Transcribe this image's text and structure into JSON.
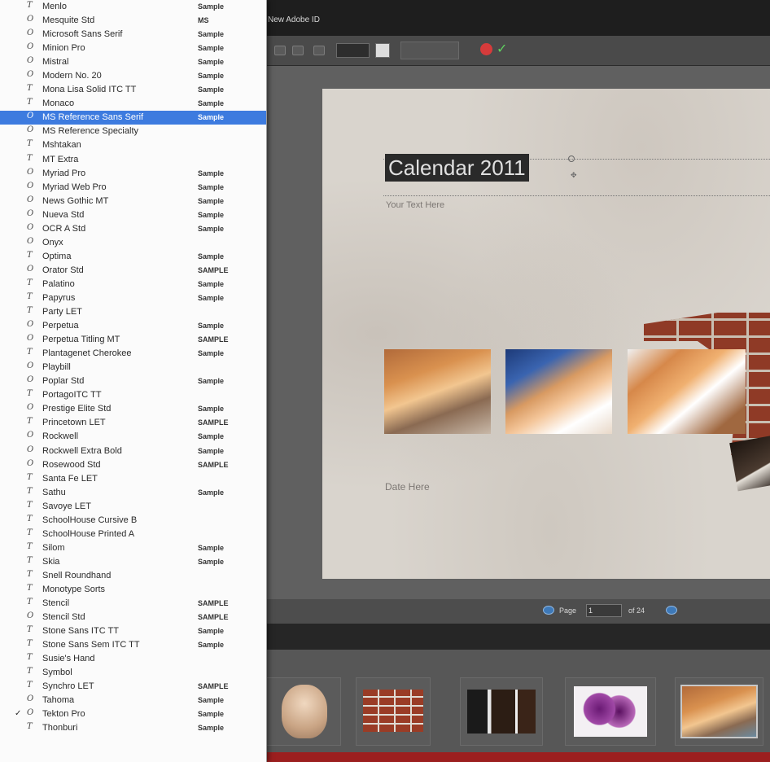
{
  "window": {
    "title": "New Adobe ID"
  },
  "font_menu": {
    "fonts": [
      {
        "name": "Menlo",
        "sample": "Sample",
        "type_icon": "truetype-icon",
        "checked": false,
        "selected": false
      },
      {
        "name": "Mesquite Std",
        "sample": "MS",
        "type_icon": "opentype-icon",
        "checked": false,
        "selected": false
      },
      {
        "name": "Microsoft Sans Serif",
        "sample": "Sample",
        "type_icon": "opentype-icon",
        "checked": false,
        "selected": false
      },
      {
        "name": "Minion Pro",
        "sample": "Sample",
        "type_icon": "opentype-icon",
        "checked": false,
        "selected": false
      },
      {
        "name": "Mistral",
        "sample": "Sample",
        "type_icon": "opentype-icon",
        "checked": false,
        "selected": false
      },
      {
        "name": "Modern No. 20",
        "sample": "Sample",
        "type_icon": "opentype-icon",
        "checked": false,
        "selected": false
      },
      {
        "name": "Mona Lisa Solid ITC TT",
        "sample": "Sample",
        "type_icon": "truetype-icon",
        "checked": false,
        "selected": false
      },
      {
        "name": "Monaco",
        "sample": "Sample",
        "type_icon": "truetype-icon",
        "checked": false,
        "selected": false
      },
      {
        "name": "MS Reference Sans Serif",
        "sample": "Sample",
        "type_icon": "opentype-icon",
        "checked": false,
        "selected": true
      },
      {
        "name": "MS Reference Specialty",
        "sample": "",
        "type_icon": "opentype-icon",
        "checked": false,
        "selected": false
      },
      {
        "name": "Mshtakan",
        "sample": "",
        "type_icon": "truetype-icon",
        "checked": false,
        "selected": false
      },
      {
        "name": "MT Extra",
        "sample": "",
        "type_icon": "truetype-icon",
        "checked": false,
        "selected": false
      },
      {
        "name": "Myriad Pro",
        "sample": "Sample",
        "type_icon": "opentype-icon",
        "checked": false,
        "selected": false
      },
      {
        "name": "Myriad Web Pro",
        "sample": "Sample",
        "type_icon": "opentype-icon",
        "checked": false,
        "selected": false
      },
      {
        "name": "News Gothic MT",
        "sample": "Sample",
        "type_icon": "opentype-icon",
        "checked": false,
        "selected": false
      },
      {
        "name": "Nueva Std",
        "sample": "Sample",
        "type_icon": "opentype-icon",
        "checked": false,
        "selected": false
      },
      {
        "name": "OCR A Std",
        "sample": "Sample",
        "type_icon": "opentype-icon",
        "checked": false,
        "selected": false
      },
      {
        "name": "Onyx",
        "sample": "",
        "type_icon": "opentype-icon",
        "checked": false,
        "selected": false
      },
      {
        "name": "Optima",
        "sample": "Sample",
        "type_icon": "truetype-icon",
        "checked": false,
        "selected": false
      },
      {
        "name": "Orator Std",
        "sample": "SAMPLE",
        "type_icon": "opentype-icon",
        "checked": false,
        "selected": false
      },
      {
        "name": "Palatino",
        "sample": "Sample",
        "type_icon": "truetype-icon",
        "checked": false,
        "selected": false
      },
      {
        "name": "Papyrus",
        "sample": "Sample",
        "type_icon": "truetype-icon",
        "checked": false,
        "selected": false
      },
      {
        "name": "Party LET",
        "sample": "",
        "type_icon": "truetype-icon",
        "checked": false,
        "selected": false
      },
      {
        "name": "Perpetua",
        "sample": "Sample",
        "type_icon": "opentype-icon",
        "checked": false,
        "selected": false
      },
      {
        "name": "Perpetua Titling MT",
        "sample": "SAMPLE",
        "type_icon": "opentype-icon",
        "checked": false,
        "selected": false
      },
      {
        "name": "Plantagenet Cherokee",
        "sample": "Sample",
        "type_icon": "truetype-icon",
        "checked": false,
        "selected": false
      },
      {
        "name": "Playbill",
        "sample": "",
        "type_icon": "opentype-icon",
        "checked": false,
        "selected": false
      },
      {
        "name": "Poplar Std",
        "sample": "Sample",
        "type_icon": "opentype-icon",
        "checked": false,
        "selected": false
      },
      {
        "name": "PortagoITC TT",
        "sample": "",
        "type_icon": "truetype-icon",
        "checked": false,
        "selected": false
      },
      {
        "name": "Prestige Elite Std",
        "sample": "Sample",
        "type_icon": "opentype-icon",
        "checked": false,
        "selected": false
      },
      {
        "name": "Princetown LET",
        "sample": "SAMPLE",
        "type_icon": "truetype-icon",
        "checked": false,
        "selected": false
      },
      {
        "name": "Rockwell",
        "sample": "Sample",
        "type_icon": "opentype-icon",
        "checked": false,
        "selected": false
      },
      {
        "name": "Rockwell Extra Bold",
        "sample": "Sample",
        "type_icon": "opentype-icon",
        "checked": false,
        "selected": false
      },
      {
        "name": "Rosewood Std",
        "sample": "SAMPLE",
        "type_icon": "opentype-icon",
        "checked": false,
        "selected": false
      },
      {
        "name": "Santa Fe LET",
        "sample": "",
        "type_icon": "truetype-icon",
        "checked": false,
        "selected": false
      },
      {
        "name": "Sathu",
        "sample": "Sample",
        "type_icon": "truetype-icon",
        "checked": false,
        "selected": false
      },
      {
        "name": "Savoye LET",
        "sample": "",
        "type_icon": "truetype-icon",
        "checked": false,
        "selected": false
      },
      {
        "name": "SchoolHouse Cursive B",
        "sample": "",
        "type_icon": "truetype-icon",
        "checked": false,
        "selected": false
      },
      {
        "name": "SchoolHouse Printed A",
        "sample": "",
        "type_icon": "truetype-icon",
        "checked": false,
        "selected": false
      },
      {
        "name": "Silom",
        "sample": "Sample",
        "type_icon": "truetype-icon",
        "checked": false,
        "selected": false
      },
      {
        "name": "Skia",
        "sample": "Sample",
        "type_icon": "truetype-icon",
        "checked": false,
        "selected": false
      },
      {
        "name": "Snell Roundhand",
        "sample": "",
        "type_icon": "truetype-icon",
        "checked": false,
        "selected": false
      },
      {
        "name": "Monotype Sorts",
        "sample": "",
        "type_icon": "truetype-icon",
        "checked": false,
        "selected": false
      },
      {
        "name": "Stencil",
        "sample": "SAMPLE",
        "type_icon": "truetype-icon",
        "checked": false,
        "selected": false
      },
      {
        "name": "Stencil Std",
        "sample": "SAMPLE",
        "type_icon": "opentype-icon",
        "checked": false,
        "selected": false
      },
      {
        "name": "Stone Sans ITC TT",
        "sample": "Sample",
        "type_icon": "truetype-icon",
        "checked": false,
        "selected": false
      },
      {
        "name": "Stone Sans Sem ITC TT",
        "sample": "Sample",
        "type_icon": "truetype-icon",
        "checked": false,
        "selected": false
      },
      {
        "name": "Susie's Hand",
        "sample": "",
        "type_icon": "truetype-icon",
        "checked": false,
        "selected": false
      },
      {
        "name": "Symbol",
        "sample": "",
        "type_icon": "truetype-icon",
        "checked": false,
        "selected": false
      },
      {
        "name": "Synchro LET",
        "sample": "SAMPLE",
        "type_icon": "truetype-icon",
        "checked": false,
        "selected": false
      },
      {
        "name": "Tahoma",
        "sample": "Sample",
        "type_icon": "opentype-icon",
        "checked": false,
        "selected": false
      },
      {
        "name": "Tekton Pro",
        "sample": "Sample",
        "type_icon": "opentype-icon",
        "checked": true,
        "selected": false
      },
      {
        "name": "Thonburi",
        "sample": "Sample",
        "type_icon": "truetype-icon",
        "checked": false,
        "selected": false
      }
    ]
  },
  "canvas": {
    "title": "Calendar 2011",
    "subtitle": "Your Text Here",
    "date_placeholder": "Date Here"
  },
  "page_nav": {
    "page_label": "Page",
    "current_page": "1",
    "of_label": "of 24"
  },
  "colors": {
    "menu_selection": "#3d7bdf",
    "cancel": "#d63b3b",
    "commit": "#5fd25f",
    "nav_buttons": "#3e79b8"
  }
}
